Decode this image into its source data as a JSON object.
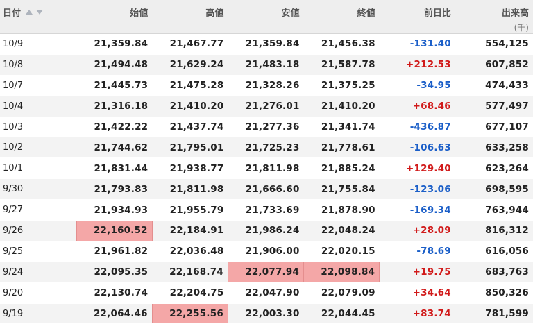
{
  "header": {
    "date": "日付",
    "open": "始値",
    "high": "高値",
    "low": "安値",
    "close": "終値",
    "change": "前日比",
    "volume": "出来高",
    "volume_unit": "(千)",
    "sort_up_icon": "sort-asc-icon",
    "sort_down_icon": "sort-desc-icon"
  },
  "colors": {
    "positive": "#d11a1a",
    "negative": "#1a5ec8",
    "highlight": "#f4a7a7"
  },
  "rows": [
    {
      "date": "10/9",
      "open": "21,359.84",
      "high": "21,467.77",
      "low": "21,359.84",
      "close": "21,456.38",
      "change": "-131.40",
      "volume": "554,125"
    },
    {
      "date": "10/8",
      "open": "21,494.48",
      "high": "21,629.24",
      "low": "21,483.18",
      "close": "21,587.78",
      "change": "+212.53",
      "volume": "607,852"
    },
    {
      "date": "10/7",
      "open": "21,445.73",
      "high": "21,475.28",
      "low": "21,328.26",
      "close": "21,375.25",
      "change": "-34.95",
      "volume": "474,433"
    },
    {
      "date": "10/4",
      "open": "21,316.18",
      "high": "21,410.20",
      "low": "21,276.01",
      "close": "21,410.20",
      "change": "+68.46",
      "volume": "577,497"
    },
    {
      "date": "10/3",
      "open": "21,422.22",
      "high": "21,437.74",
      "low": "21,277.36",
      "close": "21,341.74",
      "change": "-436.87",
      "volume": "677,107"
    },
    {
      "date": "10/2",
      "open": "21,744.62",
      "high": "21,795.01",
      "low": "21,725.23",
      "close": "21,778.61",
      "change": "-106.63",
      "volume": "633,258"
    },
    {
      "date": "10/1",
      "open": "21,831.44",
      "high": "21,938.77",
      "low": "21,811.98",
      "close": "21,885.24",
      "change": "+129.40",
      "volume": "623,264"
    },
    {
      "date": "9/30",
      "open": "21,793.83",
      "high": "21,811.98",
      "low": "21,666.60",
      "close": "21,755.84",
      "change": "-123.06",
      "volume": "698,595"
    },
    {
      "date": "9/27",
      "open": "21,934.93",
      "high": "21,955.79",
      "low": "21,733.69",
      "close": "21,878.90",
      "change": "-169.34",
      "volume": "763,944"
    },
    {
      "date": "9/26",
      "open": "22,160.52",
      "high": "22,184.91",
      "low": "21,986.24",
      "close": "22,048.24",
      "change": "+28.09",
      "volume": "816,312"
    },
    {
      "date": "9/25",
      "open": "21,961.82",
      "high": "22,036.48",
      "low": "21,906.00",
      "close": "22,020.15",
      "change": "-78.69",
      "volume": "616,056"
    },
    {
      "date": "9/24",
      "open": "22,095.35",
      "high": "22,168.74",
      "low": "22,077.94",
      "close": "22,098.84",
      "change": "+19.75",
      "volume": "683,763"
    },
    {
      "date": "9/20",
      "open": "22,130.74",
      "high": "22,204.75",
      "low": "22,047.90",
      "close": "22,079.09",
      "change": "+34.64",
      "volume": "850,326"
    },
    {
      "date": "9/19",
      "open": "22,064.46",
      "high": "22,255.56",
      "low": "22,003.30",
      "close": "22,044.45",
      "change": "+83.74",
      "volume": "781,599"
    }
  ]
}
